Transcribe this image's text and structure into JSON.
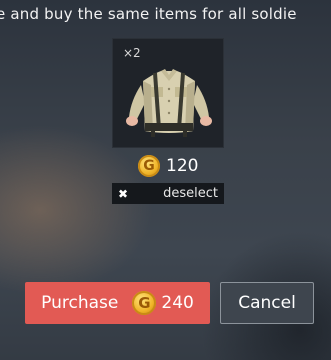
{
  "header": {
    "instruction_text": "e and buy the same items for all soldie"
  },
  "item": {
    "quantity": "×2",
    "image_icon": "shirt-with-suspenders-icon",
    "price": "120",
    "currency_icon": "gold-coin-icon",
    "currency_symbol": "G"
  },
  "deselect": {
    "icon": "close-icon",
    "icon_glyph": "✖",
    "label": "deselect"
  },
  "actions": {
    "purchase_label": "Purchase",
    "purchase_price": "240",
    "cancel_label": "Cancel"
  },
  "colors": {
    "purchase_button": "#e25a54",
    "cancel_button": "#3e454e",
    "coin_gold": "#f0b428"
  }
}
